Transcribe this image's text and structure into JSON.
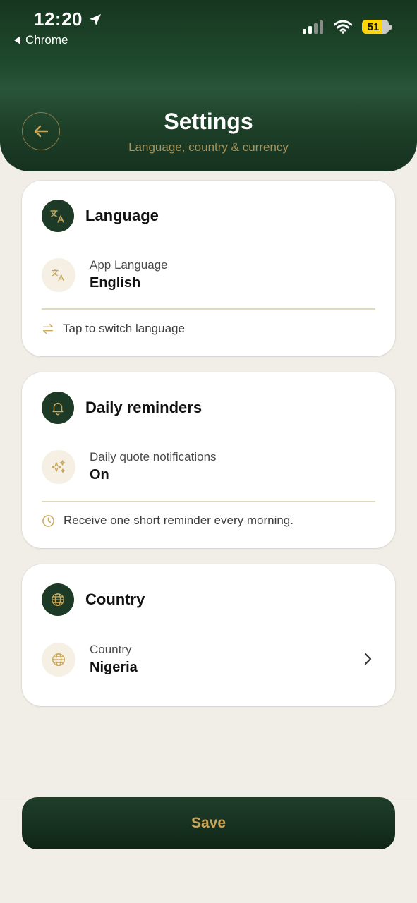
{
  "status_bar": {
    "time": "12:20",
    "back_app": "Chrome",
    "battery": "51"
  },
  "header": {
    "title": "Settings",
    "subtitle": "Language, country & currency"
  },
  "sections": {
    "language": {
      "title": "Language",
      "row_label": "App Language",
      "row_value": "English",
      "hint": "Tap to switch language"
    },
    "reminders": {
      "title": "Daily reminders",
      "row_label": "Daily quote notifications",
      "row_value": "On",
      "hint": "Receive one short reminder every morning."
    },
    "country": {
      "title": "Country",
      "row_label": "Country",
      "row_value": "Nigeria"
    }
  },
  "footer": {
    "save_label": "Save"
  },
  "colors": {
    "header_green": "#1f4a2e",
    "gold": "#c8a65a",
    "page_bg": "#f1ede7"
  },
  "icons": [
    "back-arrow-icon",
    "translate-icon",
    "swap-icon",
    "bell-icon",
    "sparkles-icon",
    "clock-icon",
    "globe-icon",
    "chevron-right-icon"
  ]
}
